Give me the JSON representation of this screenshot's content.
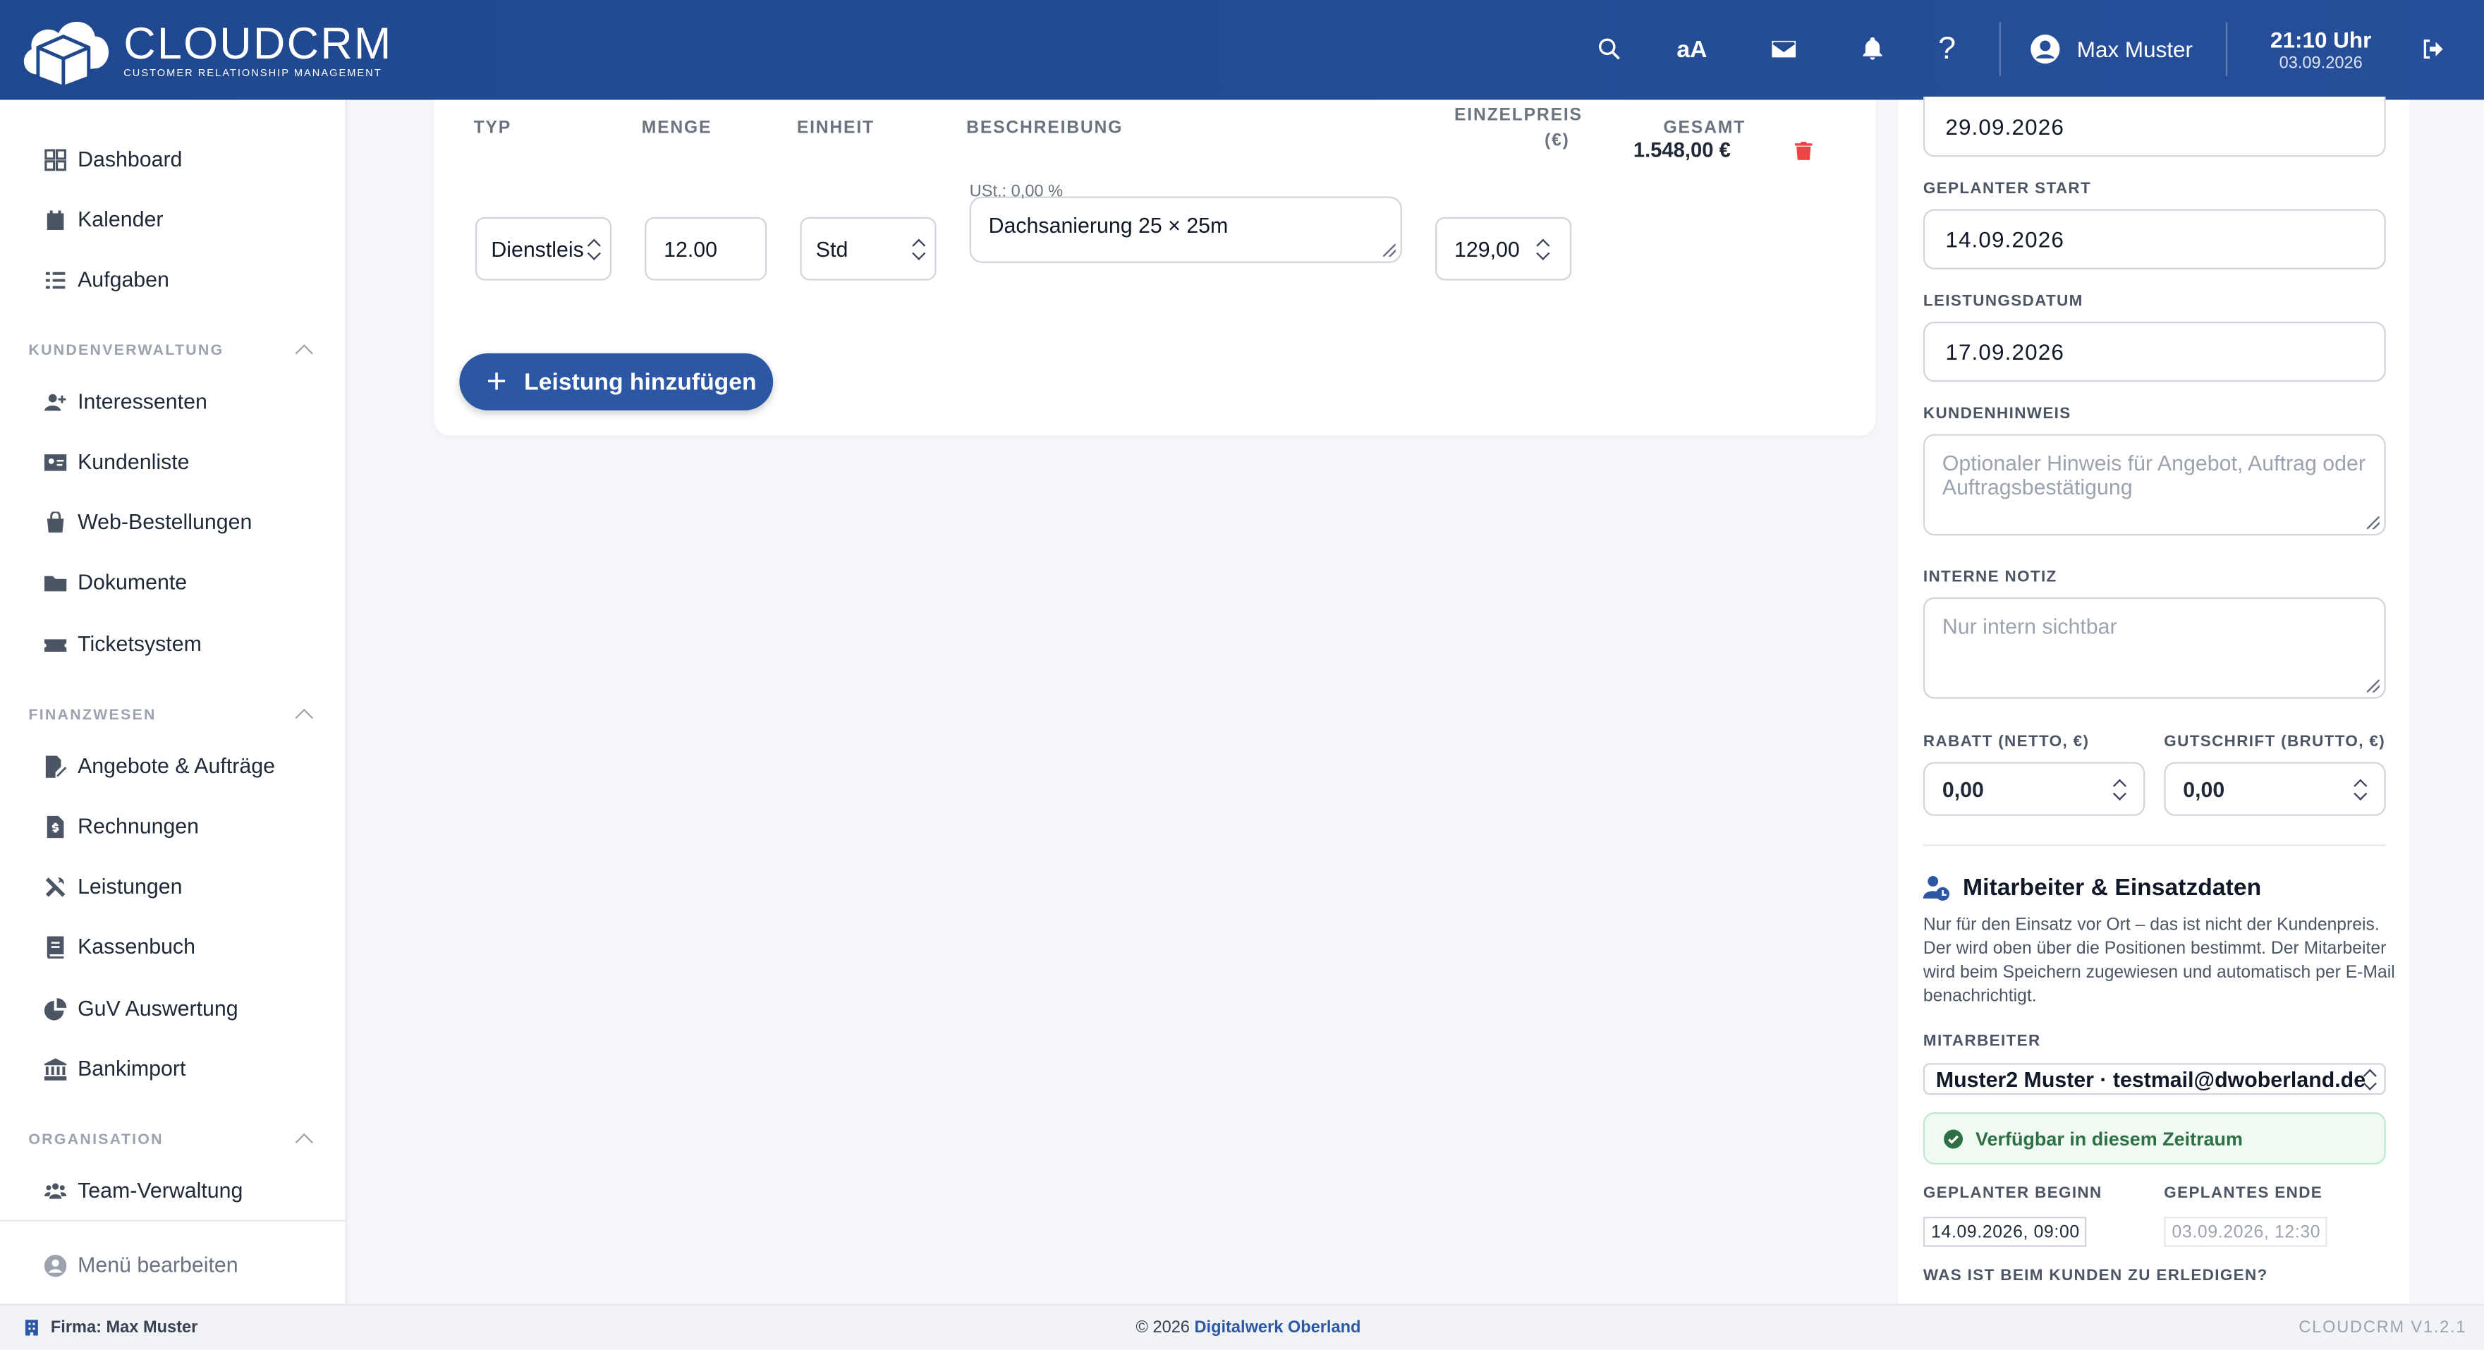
{
  "header": {
    "brand": "CLOUDCRM",
    "brand_sub": "CUSTOMER RELATIONSHIP MANAGEMENT",
    "font_toggle": "aA",
    "user_name": "Max Muster",
    "time": "21:10 Uhr",
    "date": "03.09.2026",
    "icons": [
      "search-icon",
      "font-size-icon",
      "mail-icon",
      "bell-icon",
      "help-icon",
      "user-icon",
      "logout-icon"
    ],
    "color": "#20488f"
  },
  "sidebar": {
    "items_top": [
      {
        "label": "Dashboard",
        "icon": "dashboard-icon"
      },
      {
        "label": "Kalender",
        "icon": "calendar-icon"
      },
      {
        "label": "Aufgaben",
        "icon": "tasks-icon"
      }
    ],
    "sections": [
      {
        "title": "KUNDENVERWALTUNG",
        "items": [
          {
            "label": "Interessenten",
            "icon": "user-plus-icon"
          },
          {
            "label": "Kundenliste",
            "icon": "id-card-icon"
          },
          {
            "label": "Web-Bestellungen",
            "icon": "shopping-bag-icon"
          },
          {
            "label": "Dokumente",
            "icon": "folder-icon"
          },
          {
            "label": "Ticketsystem",
            "icon": "ticket-icon"
          }
        ]
      },
      {
        "title": "FINANZWESEN",
        "items": [
          {
            "label": "Angebote & Aufträge",
            "icon": "file-signature-icon"
          },
          {
            "label": "Rechnungen",
            "icon": "invoice-icon"
          },
          {
            "label": "Leistungen",
            "icon": "tools-icon"
          },
          {
            "label": "Kassenbuch",
            "icon": "book-icon"
          },
          {
            "label": "GuV Auswertung",
            "icon": "pie-chart-icon"
          },
          {
            "label": "Bankimport",
            "icon": "bank-icon"
          }
        ]
      },
      {
        "title": "ORGANISATION",
        "items": [
          {
            "label": "Team-Verwaltung",
            "icon": "team-icon"
          }
        ]
      }
    ],
    "edit_menu": "Menü bearbeiten"
  },
  "positions": {
    "columns": {
      "typ": "TYP",
      "menge": "MENGE",
      "einheit": "EINHEIT",
      "beschreibung": "BESCHREIBUNG",
      "einzelpreis_1": "EINZELPREIS",
      "einzelpreis_2": "(€)",
      "gesamt": "GESAMT"
    },
    "row": {
      "typ": "Dienstleis",
      "menge": "12.00",
      "einheit": "Std",
      "beschreibung": "Dachsanierung 25 × 25m",
      "ust": "USt.: 0,00 %",
      "einzelpreis": "129,00",
      "gesamt": "1.548,00 €"
    },
    "add_button": "Leistung hinzufügen"
  },
  "details": {
    "top_date": "29.09.2026",
    "geplanter_start_label": "GEPLANTER START",
    "geplanter_start": "14.09.2026",
    "leistungsdatum_label": "LEISTUNGSDATUM",
    "leistungsdatum": "17.09.2026",
    "kundenhinweis_label": "KUNDENHINWEIS",
    "kundenhinweis_placeholder": "Optionaler Hinweis für Angebot, Auftrag oder Auftragsbestätigung",
    "interne_notiz_label": "INTERNE NOTIZ",
    "interne_notiz_placeholder": "Nur intern sichtbar",
    "rabatt_label": "RABATT (NETTO, €)",
    "rabatt": "0,00",
    "gutschrift_label": "GUTSCHRIFT (BRUTTO, €)",
    "gutschrift": "0,00"
  },
  "mitarbeiter": {
    "title": "Mitarbeiter & Einsatzdaten",
    "description": "Nur für den Einsatz vor Ort – das ist nicht der Kundenpreis. Der wird oben über die Positionen bestimmt. Der Mitarbeiter wird beim Speichern zugewiesen und automatisch per E-Mail benachrichtigt.",
    "label": "MITARBEITER",
    "selected": "Muster2 Muster · testmail@dwoberland.de",
    "availability": "Verfügbar in diesem Zeitraum",
    "beginn_label": "GEPLANTER BEGINN",
    "beginn": "14.09.2026, 09:00",
    "ende_label": "GEPLANTES ENDE",
    "ende": "03.09.2026, 12:30",
    "todo_label": "WAS IST BEIM KUNDEN ZU ERLEDIGEN?",
    "success_color": "#2f6f46"
  },
  "footer": {
    "firma": "Firma: Max Muster",
    "copyright": "© 2026",
    "company": "Digitalwerk Oberland",
    "version": "CLOUDCRM V1.2.1"
  }
}
